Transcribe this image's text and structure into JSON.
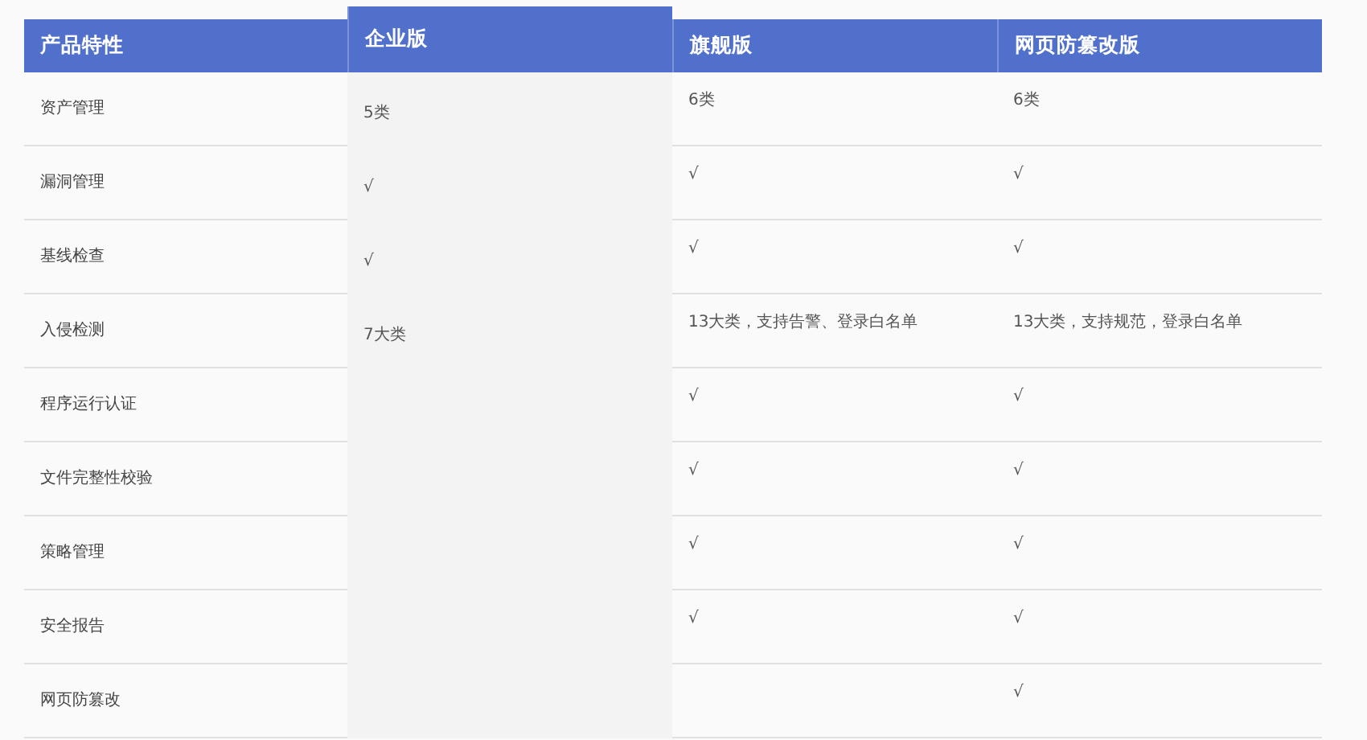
{
  "header": {
    "feature": "产品特性",
    "enterprise": {
      "label": "企业版",
      "highlighted": true
    },
    "flagship": {
      "label": "旗舰版",
      "highlighted": false
    },
    "anti_tamper": {
      "label": "网页防篡改版",
      "highlighted": false
    }
  },
  "rows": [
    {
      "feature": "资产管理",
      "enterprise": "5类",
      "flagship": "6类",
      "anti_tamper": "6类"
    },
    {
      "feature": "漏洞管理",
      "enterprise": "√",
      "flagship": "√",
      "anti_tamper": "√"
    },
    {
      "feature": "基线检查",
      "enterprise": "√",
      "flagship": "√",
      "anti_tamper": "√"
    },
    {
      "feature": "入侵检测",
      "enterprise": "7大类",
      "flagship": "13大类，支持告警、登录白名单",
      "anti_tamper": "13大类，支持规范，登录白名单"
    },
    {
      "feature": "程序运行认证",
      "flagship": "√",
      "anti_tamper": "√"
    },
    {
      "feature": "文件完整性校验",
      "flagship": "√",
      "anti_tamper": "√"
    },
    {
      "feature": "策略管理",
      "flagship": "√",
      "anti_tamper": "√"
    },
    {
      "feature": "安全报告",
      "flagship": "√",
      "anti_tamper": "√"
    },
    {
      "feature": "网页防篡改",
      "anti_tamper": "√"
    }
  ]
}
